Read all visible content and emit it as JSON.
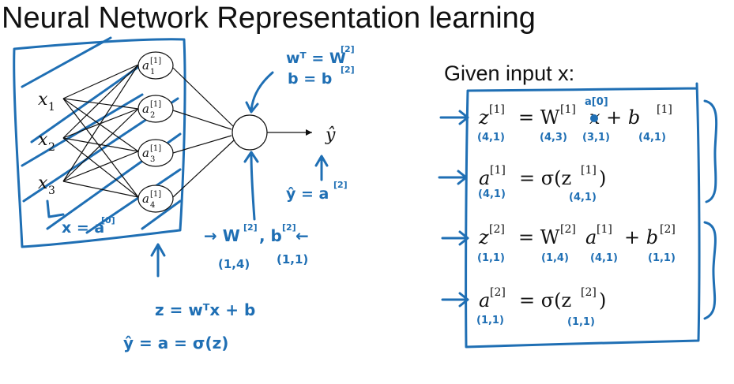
{
  "title": "Neural Network Representation learning",
  "given_label": "Given input x:",
  "network": {
    "inputs": [
      {
        "sym": "x",
        "sub": "1"
      },
      {
        "sym": "x",
        "sub": "2"
      },
      {
        "sym": "x",
        "sub": "3"
      }
    ],
    "hidden": [
      {
        "sym": "a",
        "sup": "[1]",
        "sub": "1"
      },
      {
        "sym": "a",
        "sup": "[1]",
        "sub": "2"
      },
      {
        "sym": "a",
        "sup": "[1]",
        "sub": "3"
      },
      {
        "sym": "a",
        "sup": "[1]",
        "sub": "4"
      }
    ],
    "output": {
      "sym": "ŷ"
    }
  },
  "handwritten": {
    "x_eq_a0": "x = a",
    "x_eq_a0_sup": "[0]",
    "wt_eq_w2": "wᵀ = W",
    "wt_eq_w2_sup": "[2]",
    "b_eq_b2": "b = b",
    "b_eq_b2_sup": "[2]",
    "yhat_eq_a2": "ŷ = a",
    "yhat_eq_a2_sup": "[2]",
    "w2_b2": "→ W",
    "w2_sup": "[2]",
    "b2_part": ", b",
    "b2_sup": "[2]",
    "b2_arrow": " ←",
    "w2_dim": "(1,4)",
    "b2_dim": "(1,1)",
    "z_eq": "z = wᵀx + b",
    "yhat_eq": "ŷ = a = σ(z)"
  },
  "equations": [
    {
      "lhs": "z",
      "lhs_sup": "[1]",
      "rhs": "= W",
      "rhs_sup": "[1]",
      "mid": "x + b",
      "mid_sup": "[1]",
      "ink_sup": "a[0]",
      "dims": [
        "(4,1)",
        "(4,3)",
        "(3,1)",
        "(4,1)"
      ]
    },
    {
      "lhs": "a",
      "lhs_sup": "[1]",
      "rhs": "= σ(z",
      "rhs_sup": "[1]",
      "end": ")",
      "dims": [
        "(4,1)",
        "(4,1)"
      ]
    },
    {
      "lhs": "z",
      "lhs_sup": "[2]",
      "rhs": "= W",
      "rhs_sup": "[2]",
      "mid": "a",
      "mid_sup": "[1]",
      "end": "+ b",
      "end_sup": "[2]",
      "dims": [
        "(1,1)",
        "(1,4)",
        "(4,1)",
        "(1,1)"
      ]
    },
    {
      "lhs": "a",
      "lhs_sup": "[2]",
      "rhs": "= σ(z",
      "rhs_sup": "[2]",
      "end": ")",
      "dims": [
        "(1,1)",
        "(1,1)"
      ]
    }
  ],
  "colors": {
    "ink": "#1f6fb4",
    "text": "#111111",
    "background": "#ffffff"
  }
}
